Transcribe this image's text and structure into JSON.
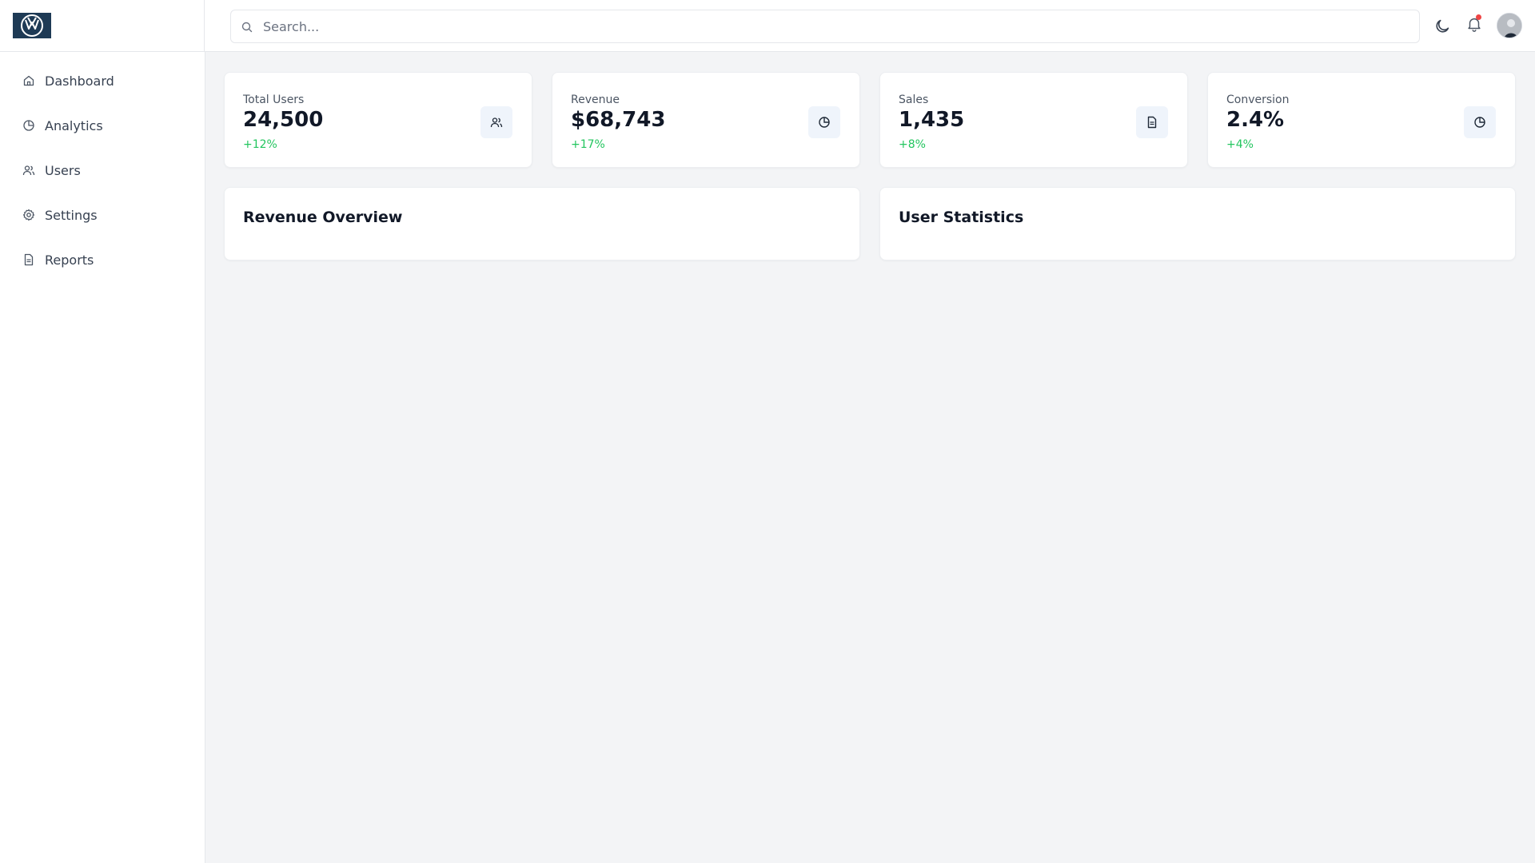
{
  "header": {
    "logo_icon": "vw-logo",
    "search": {
      "placeholder": "Search...",
      "value": ""
    },
    "icons": [
      "moon-icon",
      "bell-icon"
    ],
    "notification_dot_color": "#ef4444"
  },
  "sidebar": {
    "items": [
      {
        "label": "Dashboard",
        "icon": "home-icon"
      },
      {
        "label": "Analytics",
        "icon": "pie-chart-icon"
      },
      {
        "label": "Users",
        "icon": "users-icon"
      },
      {
        "label": "Settings",
        "icon": "gear-icon"
      },
      {
        "label": "Reports",
        "icon": "file-icon"
      }
    ]
  },
  "stats": [
    {
      "label": "Total Users",
      "value": "24,500",
      "change": "+12%",
      "icon": "users-icon"
    },
    {
      "label": "Revenue",
      "value": "$68,743",
      "change": "+17%",
      "icon": "pie-chart-icon"
    },
    {
      "label": "Sales",
      "value": "1,435",
      "change": "+8%",
      "icon": "file-icon"
    },
    {
      "label": "Conversion",
      "value": "2.4%",
      "change": "+4%",
      "icon": "pie-chart-icon"
    }
  ],
  "panels": [
    {
      "title": "Revenue Overview"
    },
    {
      "title": "User Statistics"
    }
  ],
  "colors": {
    "positive": "#22c55e",
    "background": "#f3f4f6",
    "logo_bg": "#1e3a55"
  }
}
